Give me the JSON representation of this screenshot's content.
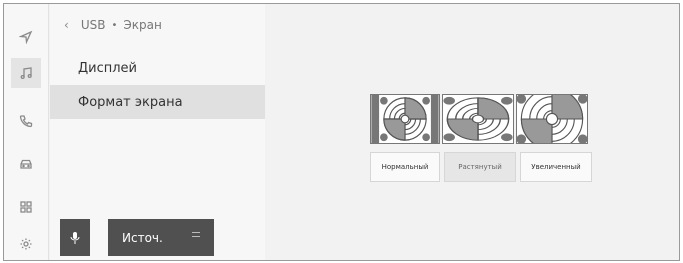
{
  "nav_rail": {
    "items": [
      {
        "icon": "navigation-icon"
      },
      {
        "icon": "music-note-icon",
        "active": true
      },
      {
        "icon": "phone-icon"
      },
      {
        "icon": "car-icon"
      },
      {
        "icon": "apps-grid-icon"
      },
      {
        "icon": "settings-gear-icon"
      }
    ]
  },
  "breadcrumb": {
    "back_icon": "back-chevron-icon",
    "source": "USB",
    "separator": "•",
    "page": "Экран"
  },
  "menu": {
    "items": [
      {
        "label": "Дисплей",
        "selected": false
      },
      {
        "label": "Формат экрана",
        "selected": true
      }
    ]
  },
  "bottom_bar": {
    "voice_icon": "microphone-icon",
    "source_label": "Источ.",
    "source_menu_icon": "menu-lines-icon"
  },
  "screen_format": {
    "options": [
      {
        "label": "Нормальный",
        "selected": false
      },
      {
        "label": "Растянутый",
        "selected": true
      },
      {
        "label": "Увеличенный",
        "selected": false
      }
    ]
  }
}
